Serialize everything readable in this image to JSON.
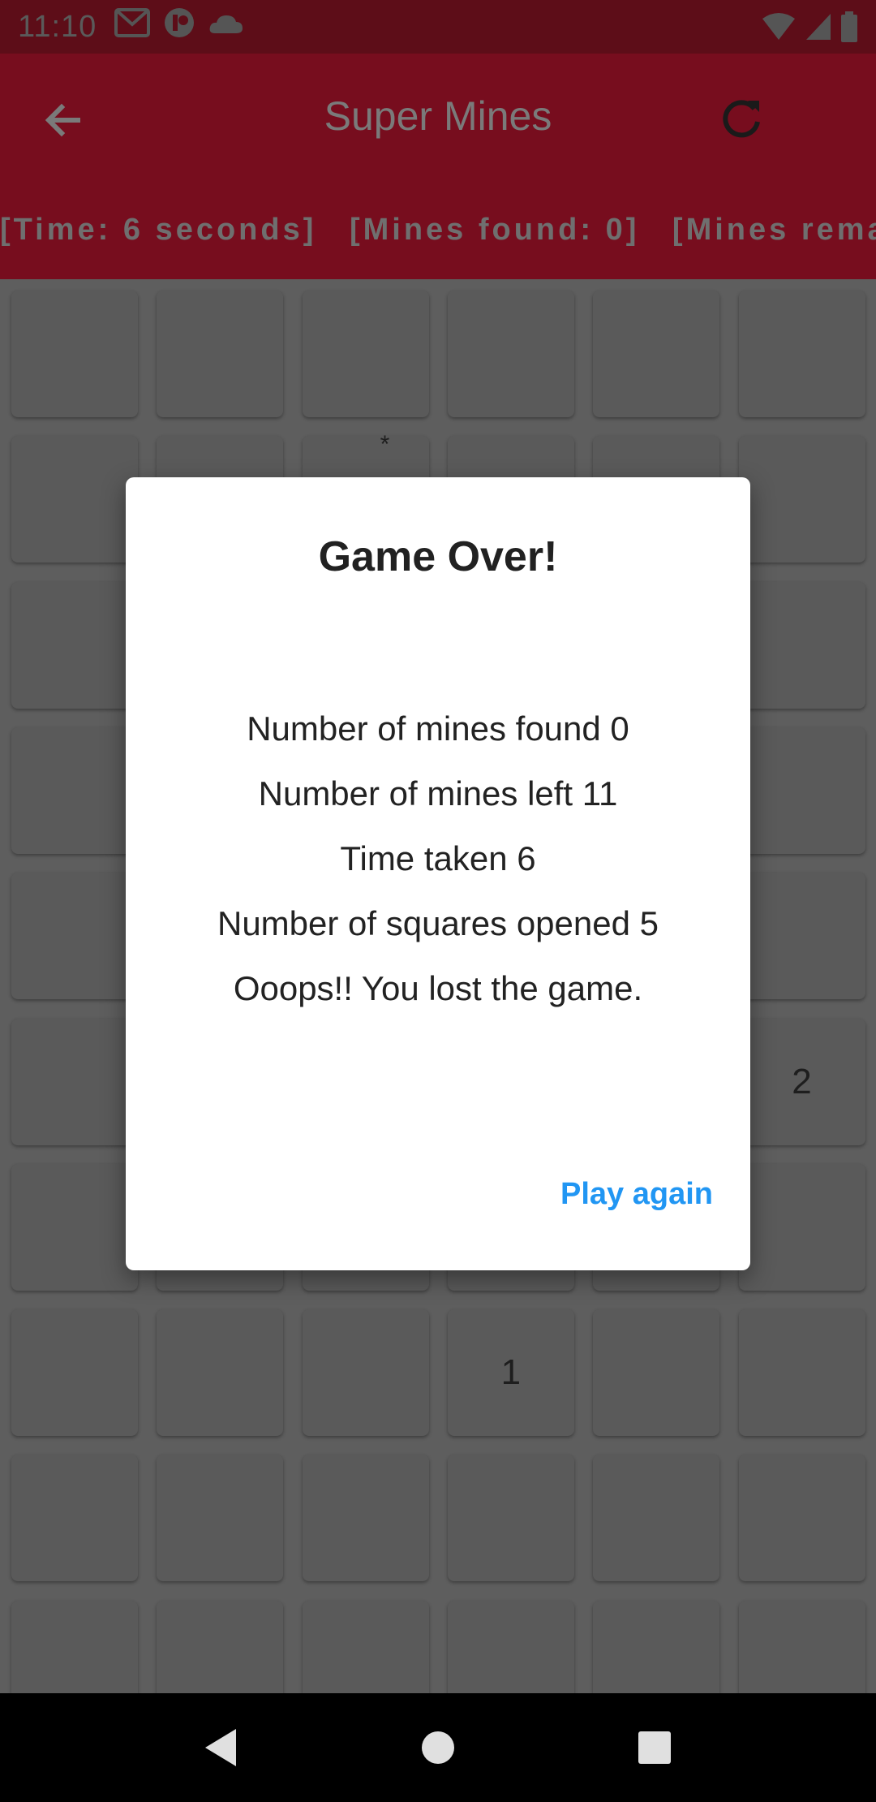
{
  "status_bar": {
    "time": "11:10",
    "icons": [
      "gmail-icon",
      "app-icon",
      "cloud-icon"
    ],
    "right_icons": [
      "wifi-icon",
      "signal-icon",
      "battery-icon"
    ]
  },
  "app_bar": {
    "title": "Super Mines",
    "back_icon": "arrow-back-icon",
    "refresh_icon": "refresh-icon"
  },
  "info_strip": {
    "time": "[Time: 6 seconds]",
    "mines_found": "[Mines found: 0]",
    "mines_remaining": "[Mines rema"
  },
  "board": {
    "columns": 6,
    "rows": 10,
    "numbers": {
      "r5c5": "2",
      "r7c3": "1"
    },
    "partial_mark": "*"
  },
  "dialog": {
    "title": "Game Over!",
    "lines": [
      "Number of mines found 0",
      "Number of mines left 11",
      "Time taken 6",
      "Number of squares opened 5",
      "Ooops!! You lost the game."
    ],
    "action_label": "Play again"
  },
  "colors": {
    "app_bar": "#770d1e",
    "status_bar": "#5d0d18",
    "accent": "#2196f3"
  }
}
